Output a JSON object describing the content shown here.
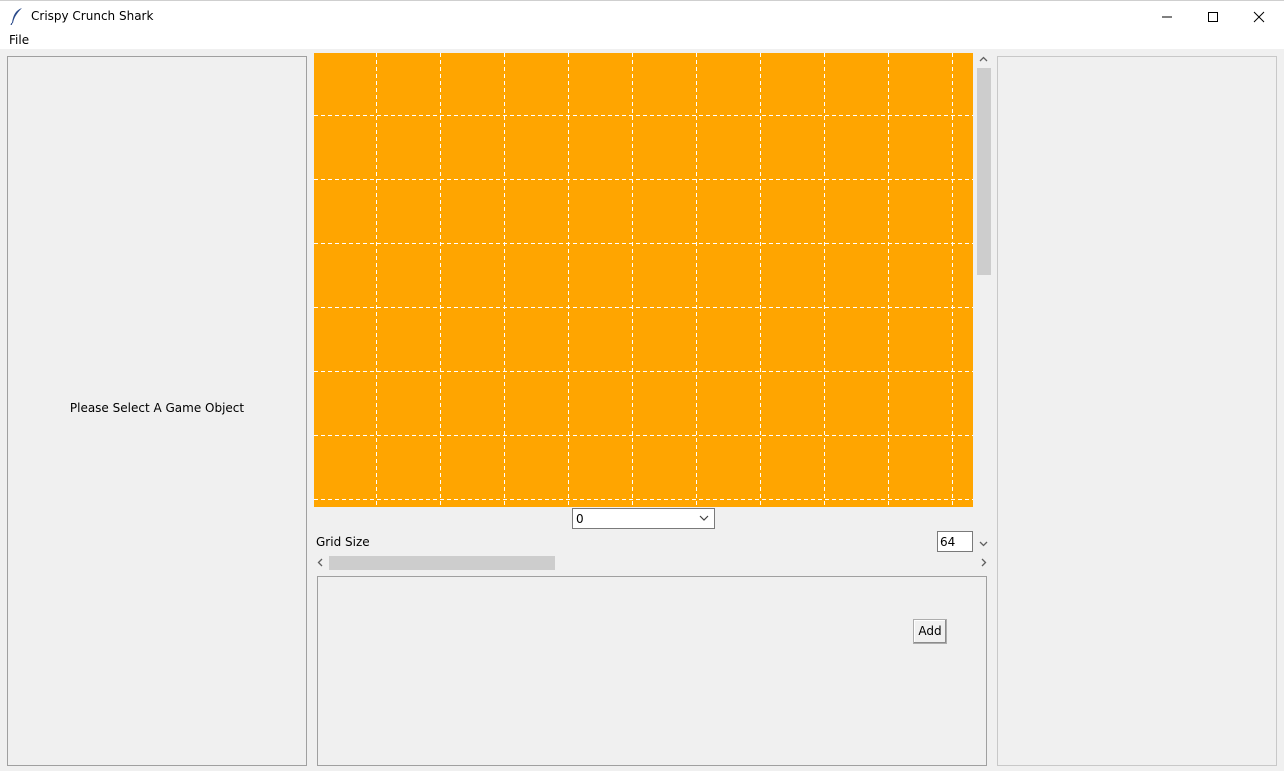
{
  "window": {
    "title": "Crispy Crunch Shark",
    "icons": {
      "app": "feather-icon",
      "minimize": "minimize-icon",
      "maximize": "maximize-icon",
      "close": "close-icon"
    }
  },
  "menubar": {
    "items": [
      {
        "label": "File"
      }
    ]
  },
  "left_panel": {
    "placeholder": "Please Select A Game Object"
  },
  "canvas": {
    "background_color": "#ffa500",
    "grid_line_color": "#ffffff",
    "grid_style": "dashed"
  },
  "layer_select": {
    "value": "0"
  },
  "grid_size": {
    "label": "Grid Size",
    "value": "64"
  },
  "bottom_panel": {
    "add_label": "Add"
  },
  "scrollbars": {
    "vertical": {
      "icons": [
        "chevron-up-icon",
        "chevron-down-icon"
      ]
    },
    "horizontal": {
      "icons": [
        "chevron-left-icon",
        "chevron-right-icon"
      ]
    }
  }
}
